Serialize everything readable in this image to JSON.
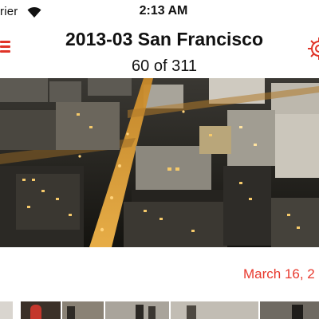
{
  "status_bar": {
    "carrier": "rier",
    "time": "2:13 AM"
  },
  "nav": {
    "title": "2013-03 San Francisco",
    "subtitle": "60 of 311",
    "accent_color": "#e03428",
    "left_icon": "hamburger-menu-icon",
    "right_icon": "gear-icon"
  },
  "photo": {
    "description_icon": "city-night-photo"
  },
  "date": {
    "label": "March 16, 2",
    "color": "#e8392d"
  },
  "thumbnails": {
    "count": 6
  }
}
